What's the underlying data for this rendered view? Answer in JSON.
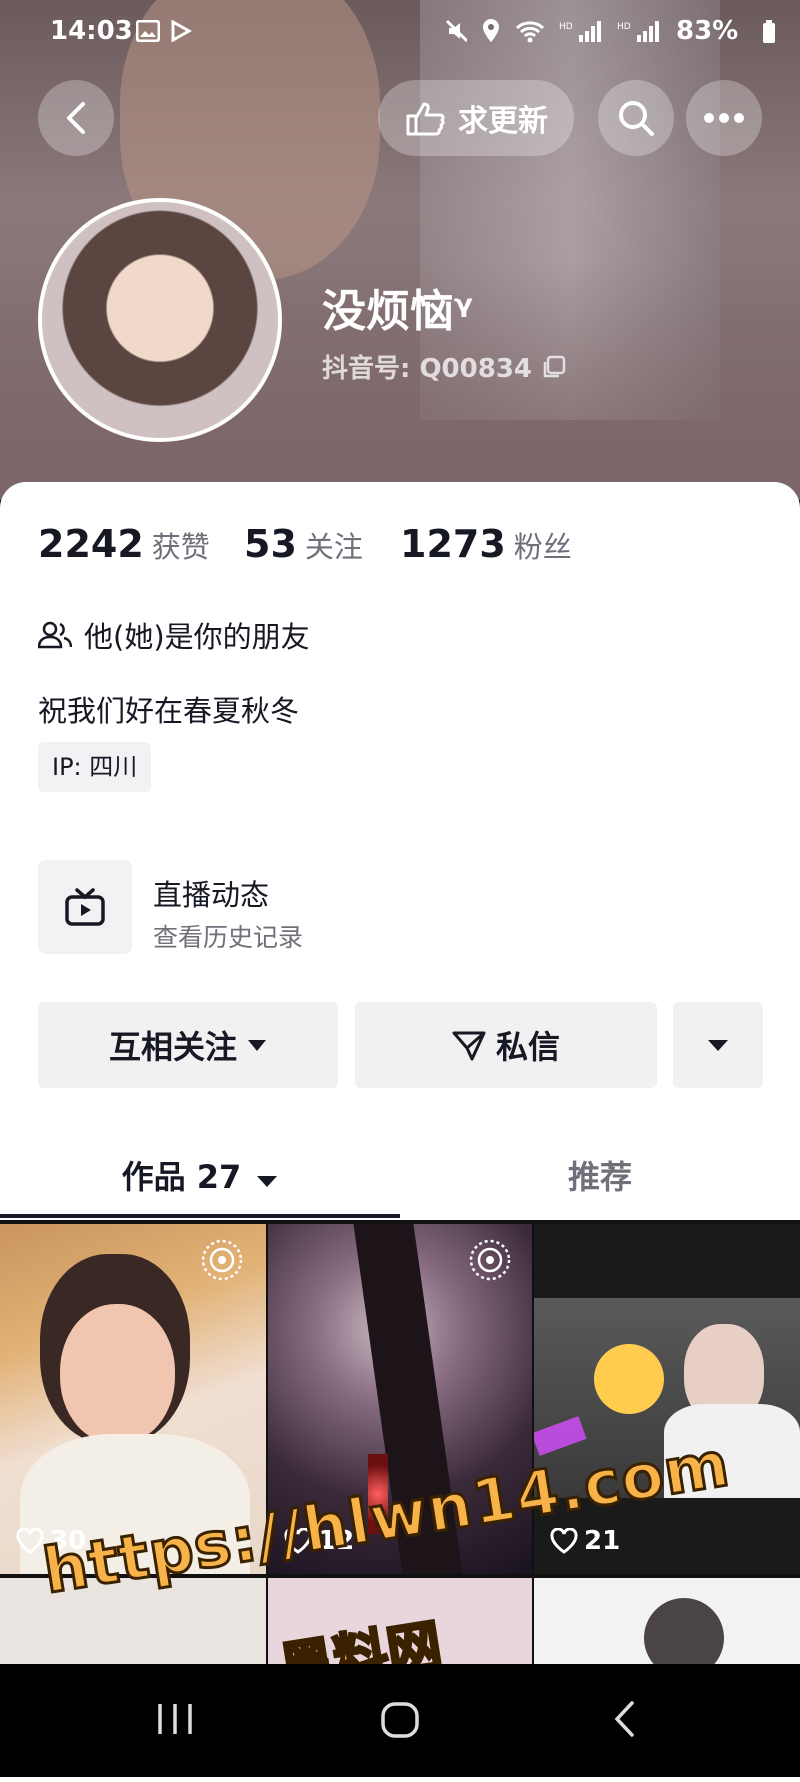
{
  "status_bar": {
    "time": "14:03",
    "battery": "83%"
  },
  "header": {
    "update_request_label": "求更新"
  },
  "profile": {
    "name": "没烦恼ᵞ",
    "douyin_id": "抖音号: Q00834",
    "stats": [
      {
        "value": "2242",
        "label": "获赞"
      },
      {
        "value": "53",
        "label": "关注"
      },
      {
        "value": "1273",
        "label": "粉丝"
      }
    ],
    "friend_note": "他(她)是你的朋友",
    "bio": "祝我们好在春夏秋冬",
    "ip": "IP: 四川"
  },
  "live": {
    "title": "直播动态",
    "subtitle": "查看历史记录"
  },
  "actions": {
    "follow_label": "互相关注",
    "message_label": "私信"
  },
  "tabs": {
    "works_label": "作品 27",
    "recommend_label": "推荐"
  },
  "grid": [
    {
      "likes": "30"
    },
    {
      "likes": "12"
    },
    {
      "likes": "21"
    }
  ],
  "watermark": {
    "url": "https://hlwn14.com",
    "name": "黑料网"
  },
  "colors": {
    "accent_text": "#161823",
    "muted": "#6f7079",
    "button_bg": "#f1f1f2",
    "watermark": "#f7b34a"
  }
}
